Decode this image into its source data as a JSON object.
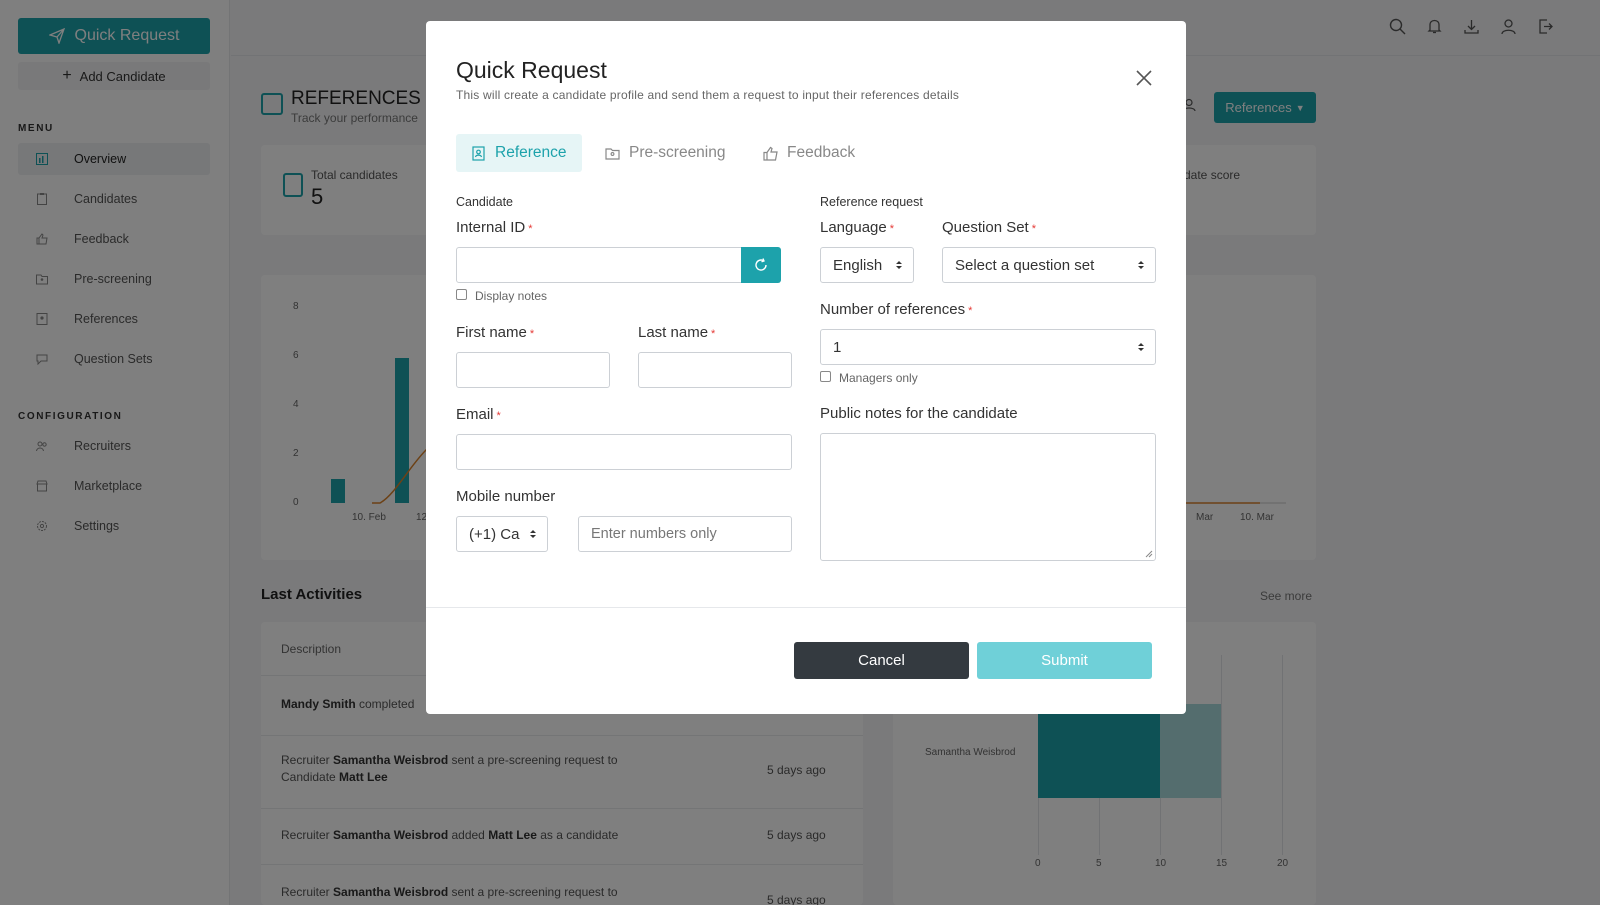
{
  "sidebar": {
    "quick_request": "Quick Request",
    "add_candidate": "Add Candidate",
    "menu_label": "MENU",
    "config_label": "CONFIGURATION",
    "menu_items": [
      {
        "label": "Overview",
        "icon": "chart-icon"
      },
      {
        "label": "Candidates",
        "icon": "clipboard-icon"
      },
      {
        "label": "Feedback",
        "icon": "thumbs-up-icon"
      },
      {
        "label": "Pre-screening",
        "icon": "folder-user-icon"
      },
      {
        "label": "References",
        "icon": "contact-card-icon"
      },
      {
        "label": "Question Sets",
        "icon": "chat-bubble-icon"
      }
    ],
    "config_items": [
      {
        "label": "Recruiters",
        "icon": "users-icon"
      },
      {
        "label": "Marketplace",
        "icon": "store-icon"
      },
      {
        "label": "Settings",
        "icon": "gear-icon"
      }
    ]
  },
  "page": {
    "title": "REFERENCES C",
    "subtitle": "Track your performance",
    "references_button": "References",
    "stat_total_label": "Total candidates",
    "stat_total_value": "5",
    "stat_right_label": "date score"
  },
  "chart_bg": {
    "y_ticks": [
      "8",
      "6",
      "4",
      "2",
      "0"
    ],
    "x_ticks": [
      "10. Feb",
      "12",
      "Mar",
      "10. Mar"
    ]
  },
  "activities": {
    "title": "Last Activities",
    "see_more": "See more",
    "column": "Description",
    "rows": [
      {
        "a": "Mandy Smith",
        "b": " completed",
        "time": ""
      },
      {
        "pre": "Recruiter ",
        "a": "Samantha Weisbrod",
        "mid": " sent a pre-screening request to Candidate ",
        "c": "Matt Lee",
        "time": "5 days ago"
      },
      {
        "pre": "Recruiter ",
        "a": "Samantha Weisbrod",
        "mid": " added ",
        "c": "Matt Lee",
        "post": " as a candidate",
        "time": "5 days ago"
      },
      {
        "pre": "Recruiter ",
        "a": "Samantha Weisbrod",
        "mid": " sent a pre-screening request to",
        "time": "5 days ago"
      }
    ]
  },
  "hbar": {
    "label": "Samantha Weisbrod",
    "x_ticks": [
      "0",
      "5",
      "10",
      "15",
      "20"
    ]
  },
  "modal": {
    "title": "Quick Request",
    "subtitle": "This will create a candidate profile and send them a request to input their references details",
    "tabs": [
      "Reference",
      "Pre-screening",
      "Feedback"
    ],
    "candidate_section": "Candidate",
    "internal_id_label": "Internal ID",
    "display_notes": "Display notes",
    "first_name_label": "First name",
    "last_name_label": "Last name",
    "email_label": "Email",
    "mobile_label": "Mobile number",
    "mobile_code": "(+1) Ca",
    "mobile_placeholder": "Enter numbers only",
    "reference_section": "Reference request",
    "language_label": "Language",
    "language_value": "English",
    "question_set_label": "Question Set",
    "question_set_value": "Select a question set",
    "num_refs_label": "Number of references",
    "num_refs_value": "1",
    "managers_only": "Managers only",
    "public_notes_label": "Public notes for the candidate",
    "cancel": "Cancel",
    "submit": "Submit",
    "required_mark": "*"
  },
  "colors": {
    "accent": "#1da2ab",
    "accent_light": "#6fd0d8",
    "dark_button": "#343a40",
    "required": "#e53935"
  }
}
